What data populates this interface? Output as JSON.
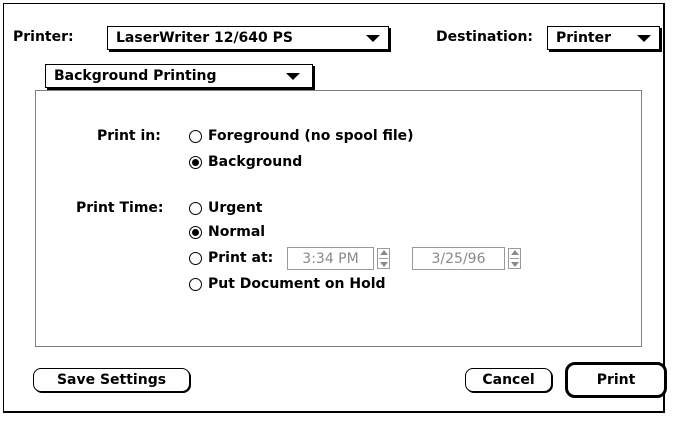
{
  "header": {
    "printer_label": "Printer:",
    "printer_value": "LaserWriter 12/640 PS",
    "destination_label": "Destination:",
    "destination_value": "Printer"
  },
  "panel_selector": {
    "value": "Background Printing"
  },
  "print_in": {
    "label": "Print in:",
    "options": [
      {
        "label": "Foreground (no spool file)",
        "selected": false
      },
      {
        "label": "Background",
        "selected": true
      }
    ]
  },
  "print_time": {
    "label": "Print Time:",
    "options": [
      {
        "label": "Urgent",
        "selected": false
      },
      {
        "label": "Normal",
        "selected": true
      },
      {
        "label": "Print at:",
        "selected": false
      },
      {
        "label": "Put Document on Hold",
        "selected": false
      }
    ],
    "time_value": "3:34 PM",
    "date_value": "3/25/96"
  },
  "buttons": {
    "save_settings": "Save Settings",
    "cancel": "Cancel",
    "print": "Print"
  },
  "icons": {
    "popup_arrow": "triangle-down-icon",
    "stepper": "up-down-stepper-icon",
    "radio": "radio-button-icon"
  }
}
